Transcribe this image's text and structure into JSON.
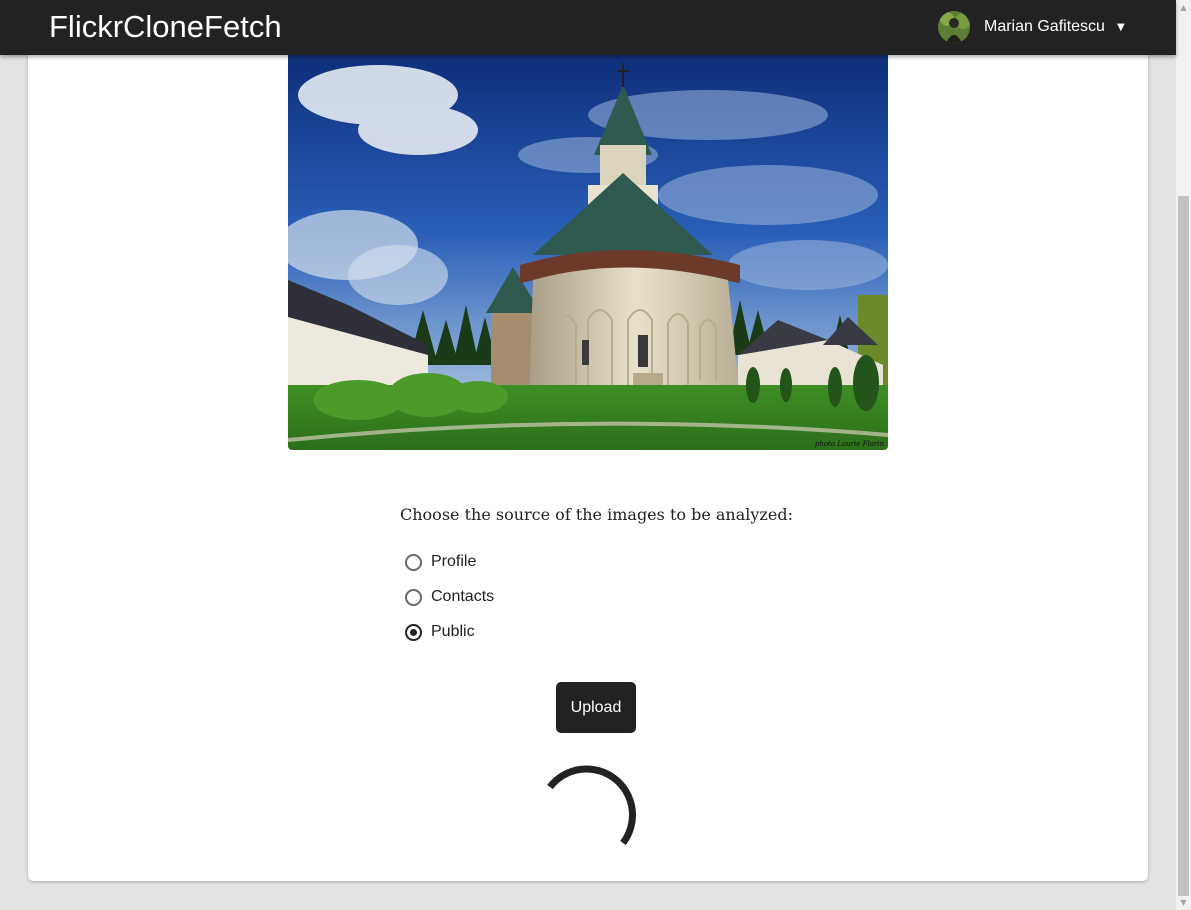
{
  "navbar": {
    "brand": "FlickrCloneFetch",
    "user_name": "Marian Gafitescu",
    "caret_icon": "caret-down-icon",
    "background": "#222222"
  },
  "hero_image": {
    "watermark": "photo Laurie Florin"
  },
  "analysis": {
    "prompt": "Choose the source of the images to be analyzed:",
    "options": [
      {
        "label": "Profile",
        "selected": false
      },
      {
        "label": "Contacts",
        "selected": false
      },
      {
        "label": "Public",
        "selected": true
      }
    ],
    "upload_label": "Upload",
    "loading_icon": "spinner-icon"
  },
  "colors": {
    "accent": "#222222",
    "page_background": "#e4e4e4",
    "card_background": "#ffffff"
  }
}
